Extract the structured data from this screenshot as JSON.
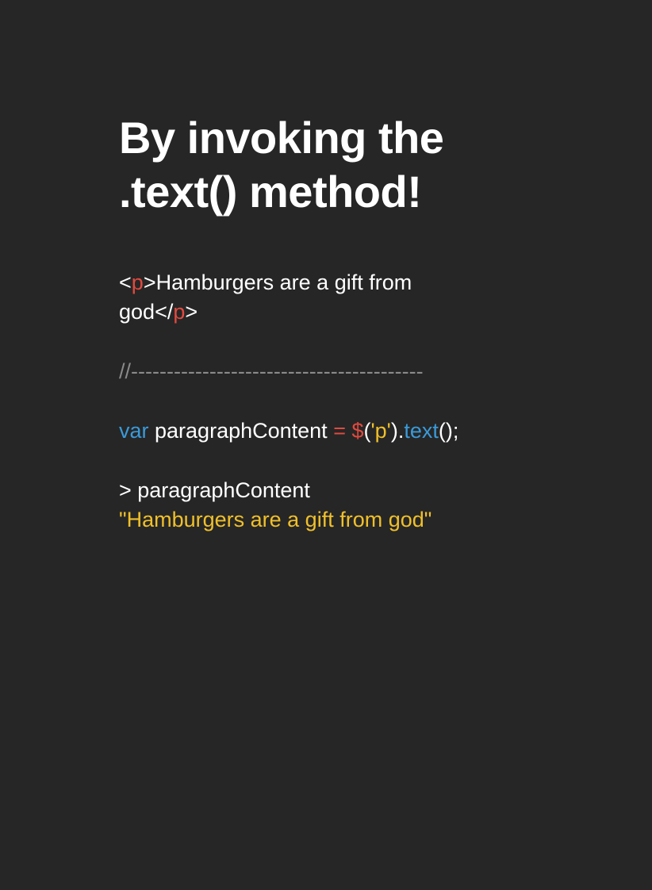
{
  "title": {
    "line1": "By invoking the",
    "line2": ".text() method!"
  },
  "html_snippet": {
    "open_lt": "<",
    "open_tag": "p",
    "open_gt": ">",
    "text_part1": "Hamburgers are a gift from",
    "text_part2": "god",
    "close_lt": "</",
    "close_tag": "p",
    "close_gt": ">"
  },
  "comment": "//-----------------------------------------",
  "js_line": {
    "keyword": "var",
    "variable": " paragraphContent ",
    "equals": "=",
    "space": " ",
    "dollar": "$",
    "paren_open": "(",
    "selector": "'p'",
    "paren_close_dot": ").",
    "method": "text",
    "call_end": "();"
  },
  "console": {
    "prompt": "> paragraphContent",
    "result": "\"Hamburgers are a gift from god\""
  },
  "colors": {
    "background": "#262626",
    "text": "#ffffff",
    "tag_red": "#e04a3f",
    "keyword_blue": "#3a9ad9",
    "string_yellow": "#f0c02a",
    "comment_gray": "#8a8a8a"
  }
}
